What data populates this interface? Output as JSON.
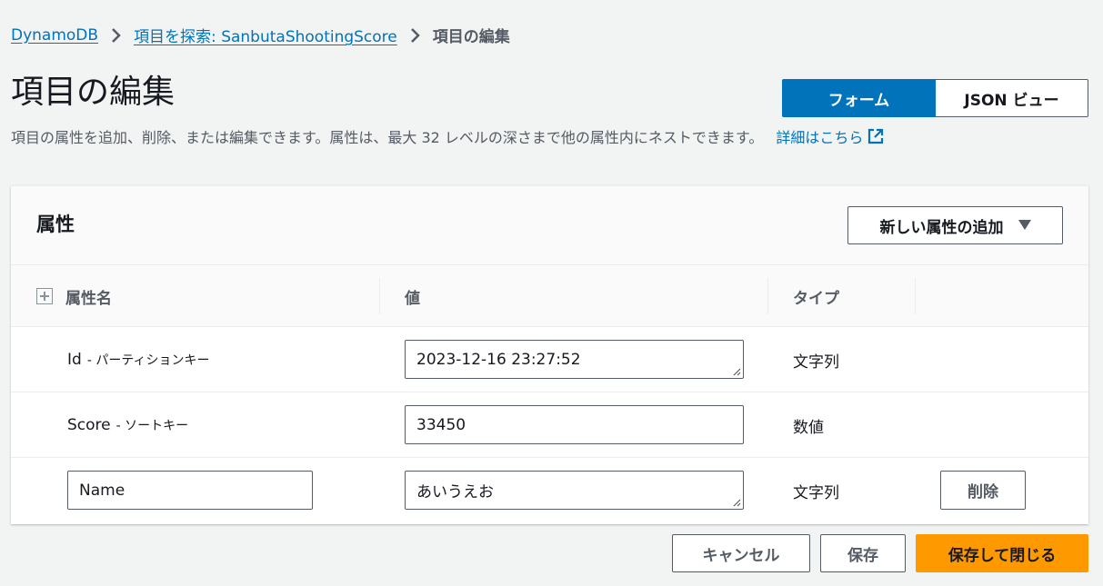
{
  "breadcrumb": {
    "items": [
      {
        "label": "DynamoDB"
      },
      {
        "label": "項目を探索: SanbutaShootingScore"
      },
      {
        "label": "項目の編集"
      }
    ]
  },
  "page": {
    "title": "項目の編集",
    "description": "項目の属性を追加、削除、または編集できます。属性は、最大 32 レベルの深さまで他の属性内にネストできます。",
    "learn_more": "詳細はこちら"
  },
  "view_toggle": {
    "form_label": "フォーム",
    "json_label": "JSON ビュー",
    "selected": "フォーム"
  },
  "panel": {
    "title": "属性",
    "add_attribute_label": "新しい属性の追加"
  },
  "table": {
    "columns": [
      "属性名",
      "値",
      "タイプ"
    ],
    "rows": [
      {
        "name": "Id",
        "key_label": "- パーティションキー",
        "value": "2023-12-16 23:27:52",
        "type": "文字列"
      },
      {
        "name": "Score",
        "key_label": "- ソートキー",
        "value": "33450",
        "type": "数値"
      },
      {
        "name": "Name",
        "value": "あいうえお",
        "type": "文字列",
        "delete_label": "削除"
      }
    ]
  },
  "footer": {
    "cancel_label": "キャンセル",
    "save_label": "保存",
    "save_close_label": "保存して閉じる"
  },
  "colors": {
    "link": "#0073bb",
    "primary": "#ff9900",
    "toggle_active": "#0073bb"
  }
}
